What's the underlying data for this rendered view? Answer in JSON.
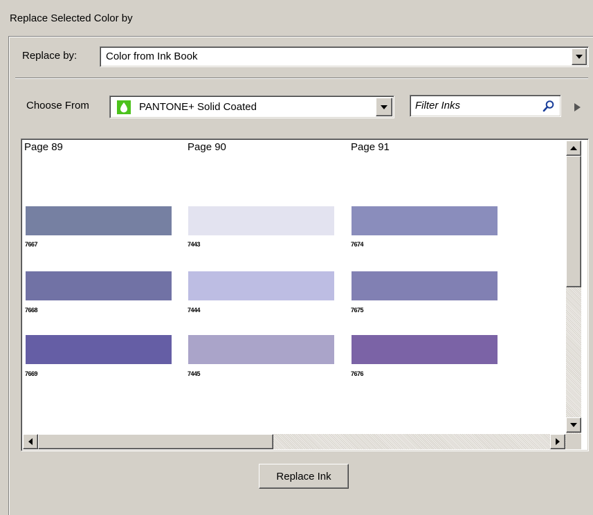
{
  "panel": {
    "title": "Replace Selected Color by"
  },
  "replace_by": {
    "label": "Replace by:",
    "value": "Color from Ink Book"
  },
  "choose_from": {
    "label": "Choose From",
    "value": "PANTONE+ Solid Coated",
    "icon": "ink-drop-icon",
    "icon_color": "#4cc21c"
  },
  "filter": {
    "placeholder": "Filter Inks",
    "icon": "search-icon"
  },
  "pages": [
    {
      "title": "Page 89",
      "swatches": [
        {
          "code": "7667",
          "color": "#7680a2"
        },
        {
          "code": "7668",
          "color": "#7172a5"
        },
        {
          "code": "7669",
          "color": "#655ea5"
        }
      ]
    },
    {
      "title": "Page 90",
      "swatches": [
        {
          "code": "7443",
          "color": "#e3e3f0"
        },
        {
          "code": "7444",
          "color": "#bdbde3"
        },
        {
          "code": "7445",
          "color": "#aaa4c9"
        }
      ]
    },
    {
      "title": "Page 91",
      "swatches": [
        {
          "code": "7674",
          "color": "#8a8dbc"
        },
        {
          "code": "7675",
          "color": "#8180b3"
        },
        {
          "code": "7676",
          "color": "#7b63a6"
        }
      ]
    }
  ],
  "actions": {
    "replace_ink": "Replace Ink"
  }
}
